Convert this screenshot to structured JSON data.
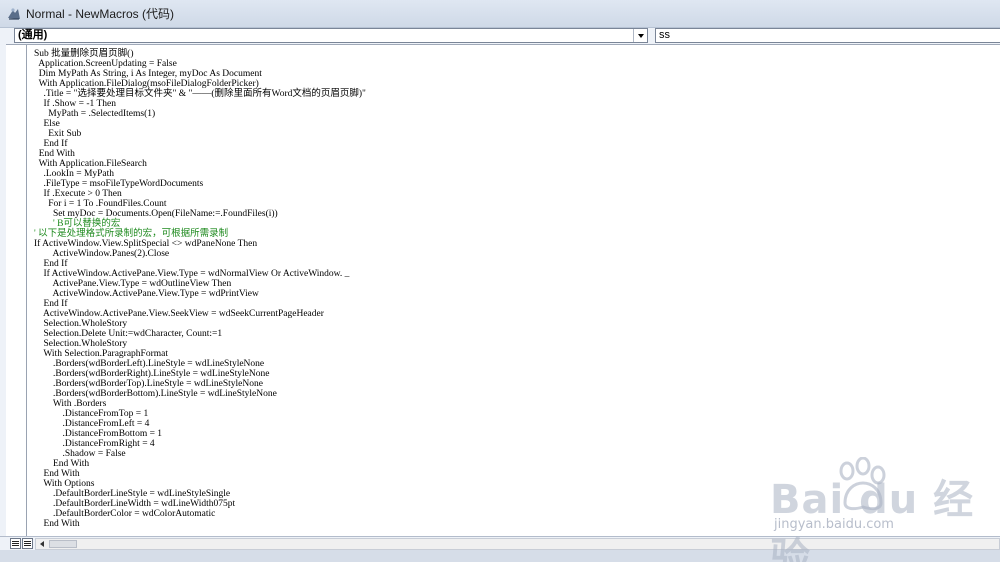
{
  "window": {
    "title": "Normal - NewMacros (代码)"
  },
  "object_box": {
    "value": "(通用)"
  },
  "procedure_box": {
    "value": "ss"
  },
  "code_lines": [
    "Sub 批量删除页眉页脚()",
    "  Application.ScreenUpdating = False",
    "  Dim MyPath As String, i As Integer, myDoc As Document",
    "  With Application.FileDialog(msoFileDialogFolderPicker)",
    "    .Title = \"选择要处理目标文件夹\" & \"——(删除里面所有Word文档的页眉页脚)\"",
    "    If .Show = -1 Then",
    "      MyPath = .SelectedItems(1)",
    "    Else",
    "      Exit Sub",
    "    End If",
    "  End With",
    "  With Application.FileSearch",
    "    .LookIn = MyPath",
    "    .FileType = msoFileTypeWordDocuments",
    "    If .Execute > 0 Then",
    "      For i = 1 To .FoundFiles.Count",
    "        Set myDoc = Documents.Open(FileName:=.FoundFiles(i))",
    "        ' B可以替换的宏",
    "' 以下是处理格式所录制的宏，可根据所需录制",
    "If ActiveWindow.View.SplitSpecial <> wdPaneNone Then",
    "        ActiveWindow.Panes(2).Close",
    "    End If",
    "    If ActiveWindow.ActivePane.View.Type = wdNormalView Or ActiveWindow. _",
    "        ActivePane.View.Type = wdOutlineView Then",
    "        ActiveWindow.ActivePane.View.Type = wdPrintView",
    "    End If",
    "    ActiveWindow.ActivePane.View.SeekView = wdSeekCurrentPageHeader",
    "    Selection.WholeStory",
    "    Selection.Delete Unit:=wdCharacter, Count:=1",
    "    Selection.WholeStory",
    "    With Selection.ParagraphFormat",
    "        .Borders(wdBorderLeft).LineStyle = wdLineStyleNone",
    "        .Borders(wdBorderRight).LineStyle = wdLineStyleNone",
    "        .Borders(wdBorderTop).LineStyle = wdLineStyleNone",
    "        .Borders(wdBorderBottom).LineStyle = wdLineStyleNone",
    "        With .Borders",
    "            .DistanceFromTop = 1",
    "            .DistanceFromLeft = 4",
    "            .DistanceFromBottom = 1",
    "            .DistanceFromRight = 4",
    "            .Shadow = False",
    "        End With",
    "    End With",
    "    With Options",
    "        .DefaultBorderLineStyle = wdLineStyleSingle",
    "        .DefaultBorderLineWidth = wdLineWidth075pt",
    "        .DefaultBorderColor = wdColorAutomatic",
    "    End With"
  ],
  "comment_lines": [
    17,
    18
  ],
  "colors": {
    "comment": "#1e8a1e",
    "code": "#000000"
  },
  "icons": {
    "title": "vba-macro-icon",
    "dropdown": "chevron-down-icon"
  },
  "watermark": {
    "logo": "Bai du 经验",
    "url": "jingyan.baidu.com"
  }
}
